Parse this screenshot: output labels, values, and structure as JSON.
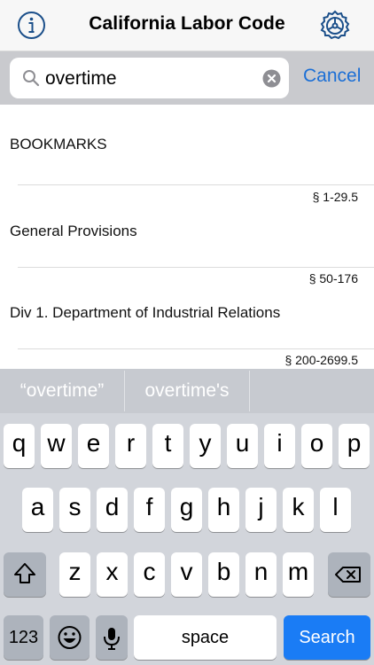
{
  "header": {
    "title": "California Labor Code",
    "info_icon": "info-circle-icon",
    "settings_icon": "gear-icon"
  },
  "search": {
    "query": "overtime",
    "cancel_label": "Cancel",
    "icon": "search-icon",
    "clear_icon": "clear-icon"
  },
  "list": {
    "items": [
      {
        "title": "BOOKMARKS",
        "range": "§ 1-29.5"
      },
      {
        "title": "General Provisions",
        "range": "§ 50-176"
      },
      {
        "title": "Div 1. Department of Industrial Relations",
        "range": "§ 200-2699.5"
      }
    ]
  },
  "suggestions": [
    "“overtime”",
    "overtime's",
    ""
  ],
  "keyboard": {
    "row1": [
      "q",
      "w",
      "e",
      "r",
      "t",
      "y",
      "u",
      "i",
      "o",
      "p"
    ],
    "row2": [
      "a",
      "s",
      "d",
      "f",
      "g",
      "h",
      "j",
      "k",
      "l"
    ],
    "row3": [
      "z",
      "x",
      "c",
      "v",
      "b",
      "n",
      "m"
    ],
    "numbers_label": "123",
    "space_label": "space",
    "search_label": "Search",
    "shift_icon": "shift-icon",
    "delete_icon": "delete-icon",
    "emoji_icon": "emoji-icon",
    "mic_icon": "microphone-icon",
    "colors": {
      "search_key": "#1a7cf5",
      "link": "#1b6fd6"
    }
  }
}
